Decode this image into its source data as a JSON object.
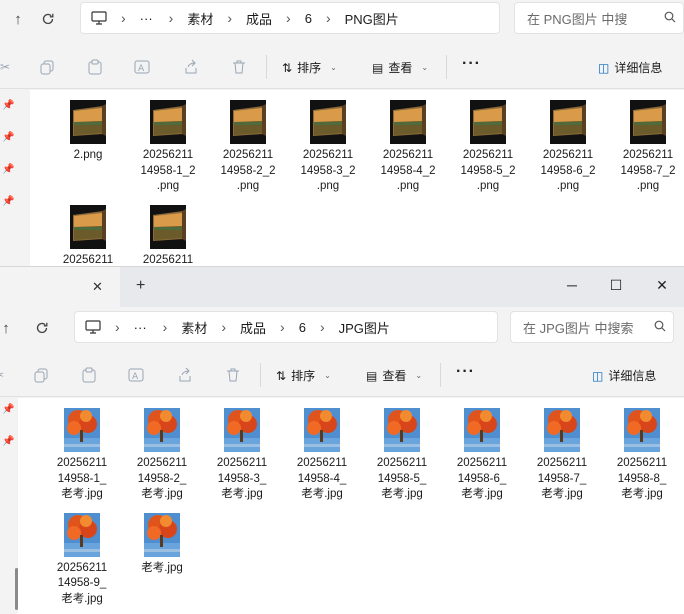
{
  "window1": {
    "breadcrumb": [
      "素材",
      "成品",
      "6",
      "PNG图片"
    ],
    "search_placeholder": "在 PNG图片 中搜",
    "toolbar": {
      "sort_label": "排序",
      "view_label": "查看",
      "details_label": "详细信息"
    },
    "files": [
      {
        "name": "2.png"
      },
      {
        "name": "20256211\n14958-1_2\n.png"
      },
      {
        "name": "20256211\n14958-2_2\n.png"
      },
      {
        "name": "20256211\n14958-3_2\n.png"
      },
      {
        "name": "20256211\n14958-4_2\n.png"
      },
      {
        "name": "20256211\n14958-5_2\n.png"
      },
      {
        "name": "20256211\n14958-6_2\n.png"
      },
      {
        "name": "20256211\n14958-7_2\n.png"
      },
      {
        "name": "20256211"
      },
      {
        "name": "20256211"
      }
    ]
  },
  "window2": {
    "window_controls": {
      "minimize": "─",
      "maximize": "☐",
      "close": "✕"
    },
    "tab_close": "✕",
    "new_tab": "+",
    "breadcrumb": [
      "素材",
      "成品",
      "6",
      "JPG图片"
    ],
    "search_placeholder": "在 JPG图片 中搜索",
    "toolbar": {
      "sort_label": "排序",
      "view_label": "查看",
      "details_label": "详细信息"
    },
    "files": [
      {
        "name": "20256211\n14958-1_\n老考.jpg"
      },
      {
        "name": "20256211\n14958-2_\n老考.jpg"
      },
      {
        "name": "20256211\n14958-3_\n老考.jpg"
      },
      {
        "name": "20256211\n14958-4_\n老考.jpg"
      },
      {
        "name": "20256211\n14958-5_\n老考.jpg"
      },
      {
        "name": "20256211\n14958-6_\n老考.jpg"
      },
      {
        "name": "20256211\n14958-7_\n老考.jpg"
      },
      {
        "name": "20256211\n14958-8_\n老考.jpg"
      },
      {
        "name": "20256211\n14958-9_\n老考.jpg"
      },
      {
        "name": "老考.jpg"
      }
    ]
  },
  "icons": {
    "back": "↑",
    "refresh": "⟳",
    "computer": "computer-icon",
    "ellipsis": "···",
    "chevron": "›",
    "search": "search-icon"
  },
  "colors": {
    "accent": "#0067c0",
    "toolbar_icon_disabled": "#9aa5b3"
  }
}
